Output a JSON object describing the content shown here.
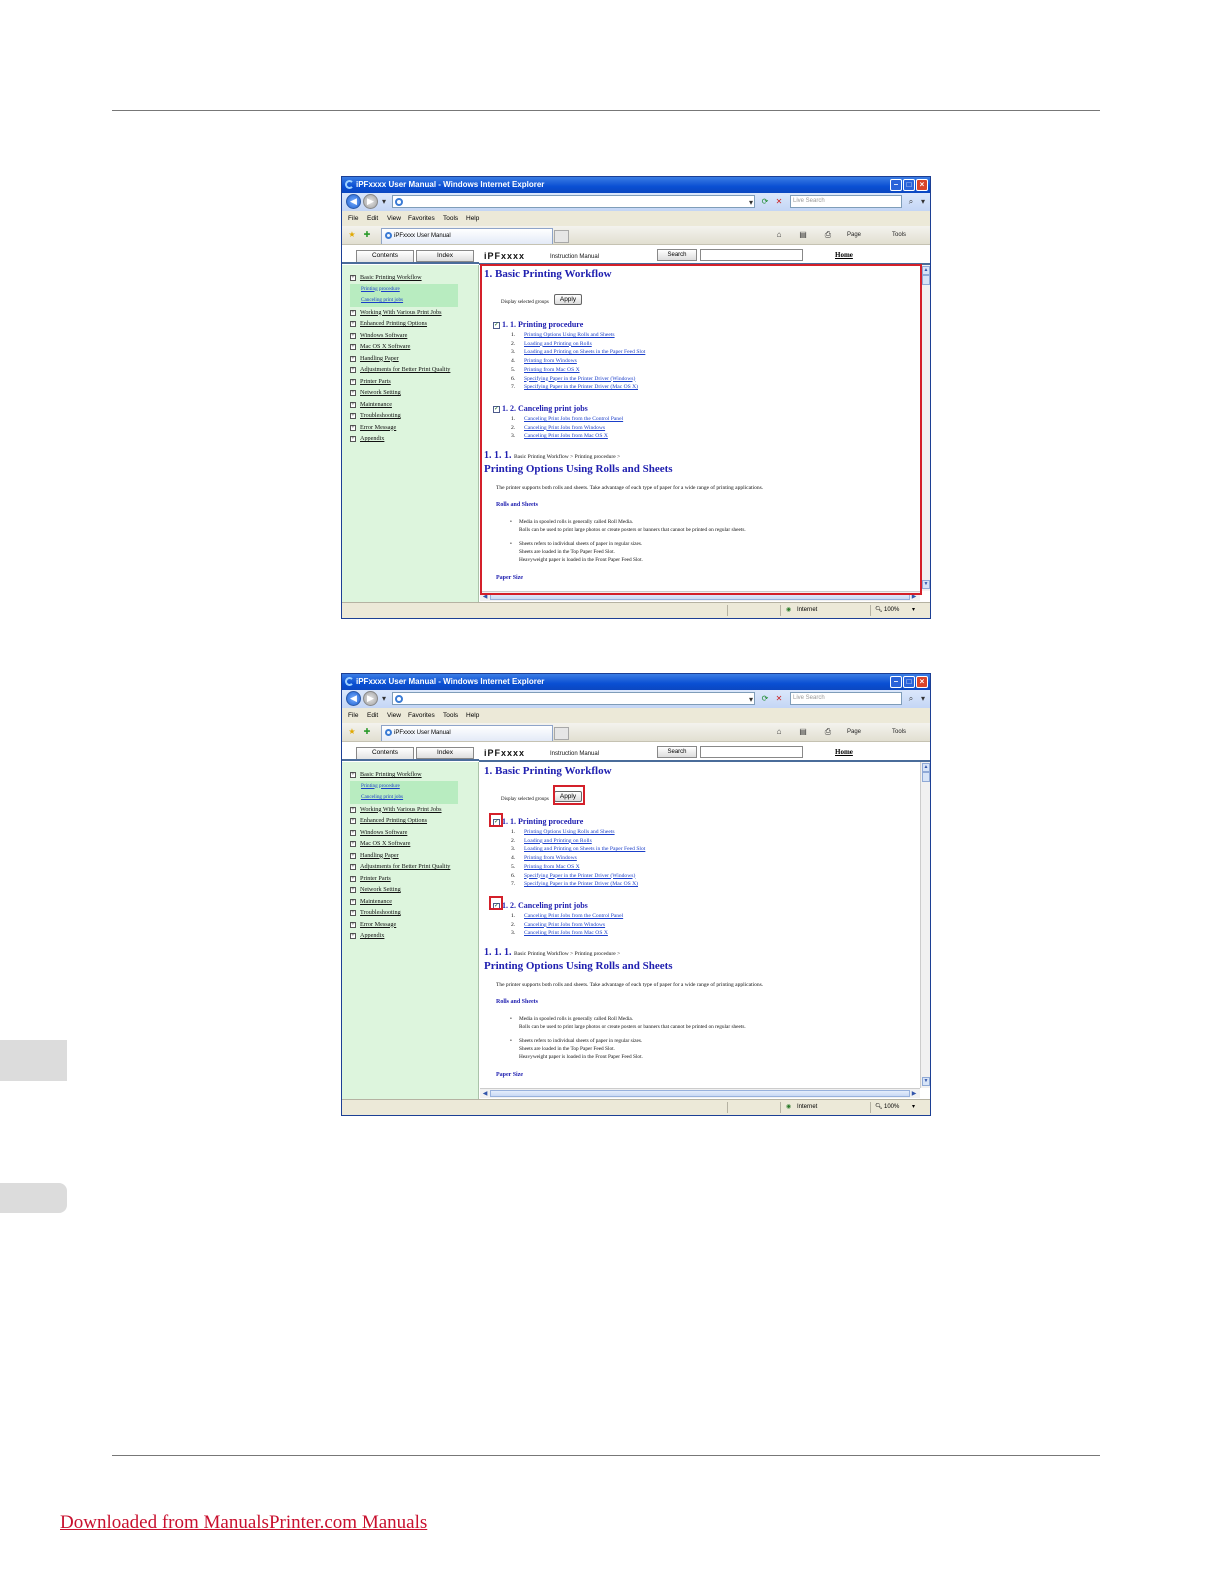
{
  "window": {
    "title": "iPFxxxx User Manual - Windows Internet Explorer",
    "search_placeholder": "Live Search",
    "menu": [
      "File",
      "Edit",
      "View",
      "Favorites",
      "Tools",
      "Help"
    ],
    "tab_title": "iPFxxxx User Manual",
    "commands": {
      "page": "Page",
      "tools": "Tools"
    },
    "status": {
      "zone": "Internet",
      "zoom": "100%"
    }
  },
  "help": {
    "tabs": {
      "contents": "Contents",
      "index": "Index"
    },
    "brand": "iPFxxxx",
    "subtitle": "Instruction Manual",
    "search_button": "Search",
    "home_link": "Home"
  },
  "tree": [
    {
      "label": "Basic Printing Workflow",
      "type": "item"
    },
    {
      "label": "Printing procedure",
      "type": "sub"
    },
    {
      "label": "Canceling print jobs",
      "type": "sub"
    },
    {
      "label": "Working With Various Print Jobs",
      "type": "item"
    },
    {
      "label": "Enhanced Printing Options",
      "type": "item"
    },
    {
      "label": "Windows Software",
      "type": "item"
    },
    {
      "label": "Mac OS X Software",
      "type": "item"
    },
    {
      "label": "Handling Paper",
      "type": "item"
    },
    {
      "label": "Adjustments for Better Print Quality",
      "type": "item"
    },
    {
      "label": "Printer Parts",
      "type": "item"
    },
    {
      "label": "Network Setting",
      "type": "item"
    },
    {
      "label": "Maintenance",
      "type": "item"
    },
    {
      "label": "Troubleshooting",
      "type": "item"
    },
    {
      "label": "Error Message",
      "type": "item"
    },
    {
      "label": "Appendix",
      "type": "item"
    }
  ],
  "content": {
    "heading": "1. Basic Printing Workflow",
    "display_label": "Display selected groups",
    "apply": "Apply",
    "section1": {
      "title": "1. 1. Printing procedure",
      "items": [
        "Printing Options Using Rolls and Sheets",
        "Loading and Printing on Rolls",
        "Loading and Printing on Sheets in the Paper Feed Slot",
        "Printing from Windows",
        "Printing from Mac OS X",
        "Specifying Paper in the Printer Driver (Windows)",
        "Specifying Paper in the Printer Driver (Mac OS X)"
      ]
    },
    "section2": {
      "title": "1. 2. Canceling print jobs",
      "items": [
        "Canceling Print Jobs from the Control Panel",
        "Canceling Print Jobs from Windows",
        "Canceling Print Jobs from Mac OS X"
      ]
    },
    "crumb_num": "1. 1. 1.",
    "crumb_path": "Basic Printing Workflow > Printing procedure >",
    "topic": "Printing Options Using Rolls and Sheets",
    "intro": "The printer supports both rolls and sheets. Take advantage of each type of paper for a wide range of printing applications.",
    "rolls_heading": "Rolls and Sheets",
    "bullet1": [
      "Media in spooled rolls is generally called Roll Media.",
      "Rolls can be used to print large photos or create posters or banners that cannot be printed on regular sheets."
    ],
    "bullet2": [
      "Sheets refers to individual sheets of paper in regular sizes.",
      "Sheets are loaded in the Top Paper Feed Slot.",
      "Heavyweight paper is loaded in the Front Paper Feed Slot."
    ],
    "paper_size": "Paper Size"
  },
  "footer": {
    "link": "Downloaded from ManualsPrinter.com Manuals"
  }
}
